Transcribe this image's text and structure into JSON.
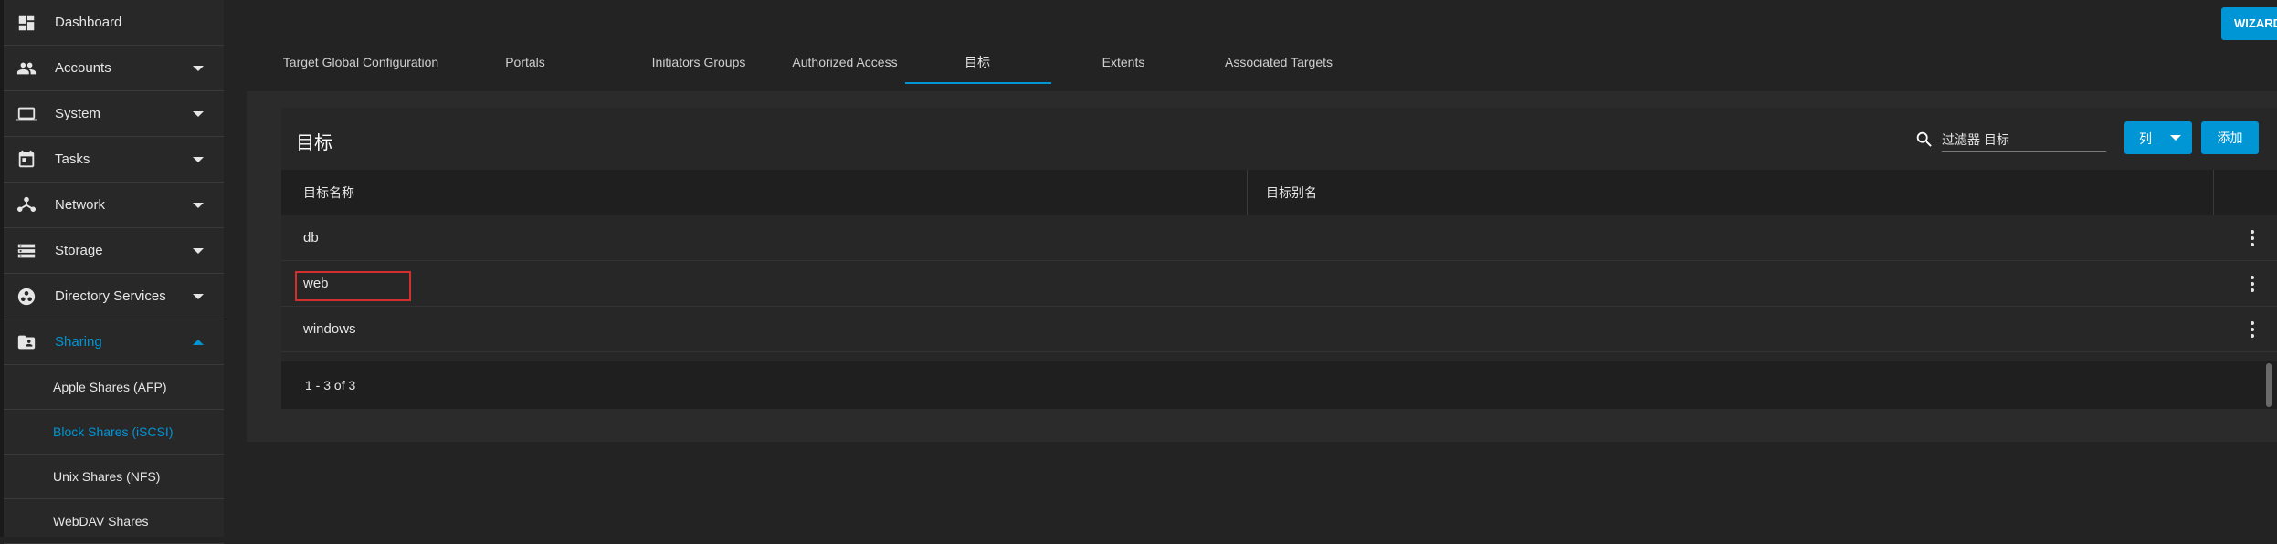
{
  "sidebar": {
    "items": [
      {
        "label": "Dashboard",
        "icon": "dashboard-icon"
      },
      {
        "label": "Accounts",
        "icon": "people-icon"
      },
      {
        "label": "System",
        "icon": "laptop-icon"
      },
      {
        "label": "Tasks",
        "icon": "calendar-icon"
      },
      {
        "label": "Network",
        "icon": "network-icon"
      },
      {
        "label": "Storage",
        "icon": "storage-icon"
      },
      {
        "label": "Directory Services",
        "icon": "directory-icon"
      },
      {
        "label": "Sharing",
        "icon": "folder-shared-icon"
      }
    ],
    "sub_items": [
      {
        "label": "Apple Shares (AFP)"
      },
      {
        "label": "Block Shares (iSCSI)"
      },
      {
        "label": "Unix Shares (NFS)"
      },
      {
        "label": "WebDAV Shares"
      }
    ]
  },
  "tabs": [
    {
      "label": "Target Global Configuration"
    },
    {
      "label": "Portals"
    },
    {
      "label": "Initiators Groups"
    },
    {
      "label": "Authorized Access"
    },
    {
      "label": "目标"
    },
    {
      "label": "Extents"
    },
    {
      "label": "Associated Targets"
    }
  ],
  "wizard_label": "WIZARD",
  "panel": {
    "title": "目标",
    "search_placeholder": "过滤器 目标",
    "columns_button": "列",
    "add_button": "添加"
  },
  "table": {
    "headers": [
      "目标名称",
      "目标别名"
    ],
    "rows": [
      {
        "name": "db",
        "alias": ""
      },
      {
        "name": "web",
        "alias": ""
      },
      {
        "name": "windows",
        "alias": ""
      }
    ],
    "range": "1 - 3 of 3"
  },
  "colors": {
    "accent": "#0095d5",
    "background": "#232323",
    "highlight": "#d32f2f"
  }
}
